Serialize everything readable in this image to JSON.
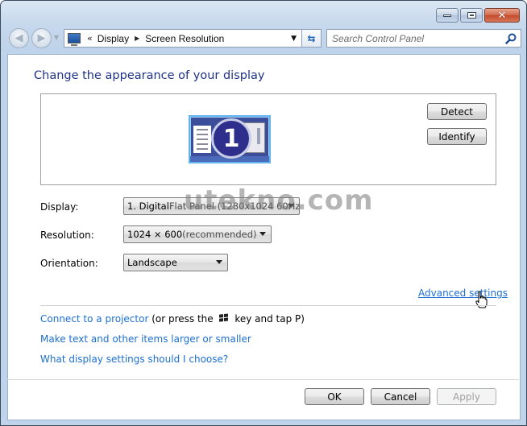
{
  "window": {
    "controls": {
      "minimize": "minimize",
      "maximize": "maximize",
      "close": "close"
    }
  },
  "navigation": {
    "back_icon": "back-arrow-icon",
    "forward_icon": "forward-arrow-icon",
    "recent_pages_icon": "chevron-down-icon",
    "address": {
      "icon": "display-control-panel-icon",
      "overflow": "«",
      "crumbs": [
        "Display",
        "Screen Resolution"
      ],
      "separator_icon": "breadcrumb-arrow-icon"
    },
    "refresh_icon": "refresh-icon",
    "search": {
      "placeholder": "Search Control Panel",
      "value": "",
      "icon": "search-icon"
    }
  },
  "main": {
    "title": "Change the appearance of your display",
    "monitor": {
      "number": "1"
    },
    "detect_label": "Detect",
    "identify_label": "Identify",
    "fields": {
      "display": {
        "label": "Display:",
        "value_strong": "1. Digital",
        "value_rest": " Flat Panel (1280x1024 60Hz)"
      },
      "resolution": {
        "label": "Resolution:",
        "value_strong": "1024 × 600",
        "value_rest": " (recommended)"
      },
      "orientation": {
        "label": "Orientation:",
        "value": "Landscape"
      }
    },
    "advanced_settings": "Advanced settings",
    "links": {
      "projector_link": "Connect to a projector",
      "projector_hint_pre": "(or press the",
      "projector_hint_post": "key and tap P)",
      "text_size": "Make text and other items larger or smaller",
      "display_help": "What display settings should I choose?"
    }
  },
  "footer": {
    "ok": "OK",
    "cancel": "Cancel",
    "apply": "Apply"
  },
  "watermark": "utekno.com"
}
